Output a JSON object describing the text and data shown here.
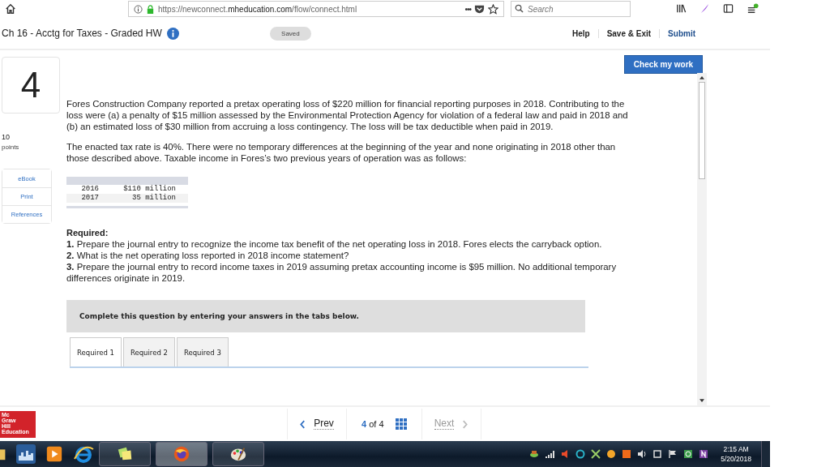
{
  "browser": {
    "url_prefix": "https://newconnect.",
    "url_domain": "mheducation.com",
    "url_path": "/flow/connect.html",
    "menu_dots": "•••",
    "search_placeholder": "Search"
  },
  "header": {
    "title": "Ch 16 - Acctg for Taxes - Graded HW",
    "status": "Saved",
    "links": [
      {
        "label": "Help",
        "kind": "plain"
      },
      {
        "label": "Save & Exit",
        "kind": "plain"
      },
      {
        "label": "Submit",
        "kind": "primary"
      }
    ]
  },
  "check_button": "Check my work",
  "question": {
    "number": "4",
    "points": "10",
    "points_label": "points"
  },
  "sidebar": [
    "eBook",
    "Print",
    "References"
  ],
  "paragraphs": [
    "Fores Construction Company reported a pretax operating loss of $220 million for financial reporting purposes in 2018. Contributing to the loss were (a) a penalty of $15 million assessed by the Environmental Protection Agency for violation of a federal law and paid in 2018 and (b) an estimated loss of $30 million from accruing a loss contingency. The loss will be tax deductible when paid in 2019.",
    "The enacted tax rate is 40%. There were no temporary differences at the beginning of the year and none originating in 2018 other than those described above. Taxable income in Fores’s two previous years of operation was as follows:"
  ],
  "income_table": [
    {
      "year": "2016",
      "amount": "$110 million"
    },
    {
      "year": "2017",
      "amount": "35 million"
    }
  ],
  "required_title": "Required:",
  "required": [
    "**1.** Prepare the journal entry to recognize the income tax benefit of the net operating loss in 2018. Fores elects the carryback option.",
    "**2.** What is the net operating loss reported in 2018 income statement?",
    "**3.** Prepare the journal entry to record income taxes in 2019 assuming pretax accounting income is $95 million. No additional temporary differences originate in 2019."
  ],
  "instruction": "Complete this question by entering your answers in the tabs below.",
  "tabs": [
    {
      "label": "Required 1",
      "selected": true
    },
    {
      "label": "Required 2",
      "selected": false
    },
    {
      "label": "Required 3",
      "selected": false
    }
  ],
  "logo": [
    "Mc",
    "Graw",
    "Hill",
    "Education"
  ],
  "pager": {
    "prev": "Prev",
    "current": "4",
    "of": "of",
    "total": "4",
    "next": "Next"
  },
  "clock": {
    "time": "2:15 AM",
    "date": "5/20/2018"
  }
}
